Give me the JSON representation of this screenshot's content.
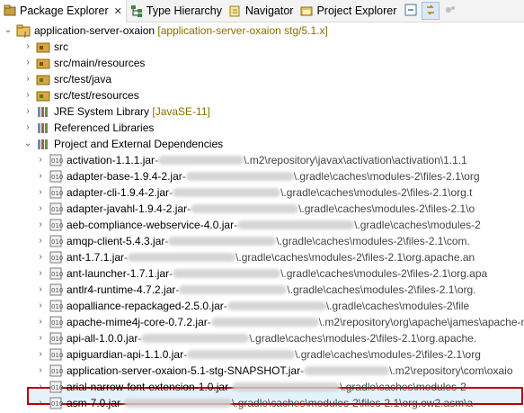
{
  "tabs": [
    {
      "label": "Package Explorer",
      "icon": "package-icon",
      "active": true,
      "close": "✕"
    },
    {
      "label": "Type Hierarchy",
      "icon": "hierarchy-icon"
    },
    {
      "label": "Navigator",
      "icon": "navigator-icon"
    },
    {
      "label": "Project Explorer",
      "icon": "project-explorer-icon"
    }
  ],
  "project": {
    "name": "application-server-oxaion",
    "decoration": "[application-server-oxaion stg/5.1.x]"
  },
  "folders": [
    {
      "label": "src"
    },
    {
      "label": "src/main/resources"
    },
    {
      "label": "src/test/java"
    },
    {
      "label": "src/test/resources"
    },
    {
      "label": "JRE System Library",
      "decoration": "[JavaSE-11]"
    },
    {
      "label": "Referenced Libraries"
    },
    {
      "label": "Project and External Dependencies"
    }
  ],
  "jars": [
    {
      "label": "activation-1.1.1.jar",
      "path": "\\.m2\\repository\\javax\\activation\\activation\\1.1.1"
    },
    {
      "label": "adapter-base-1.9.4-2.jar",
      "path": "\\.gradle\\caches\\modules-2\\files-2.1\\org"
    },
    {
      "label": "adapter-cli-1.9.4-2.jar",
      "path": "\\.gradle\\caches\\modules-2\\files-2.1\\org.t"
    },
    {
      "label": "adapter-javahl-1.9.4-2.jar",
      "path": "\\.gradle\\caches\\modules-2\\files-2.1\\o"
    },
    {
      "label": "aeb-compliance-webservice-4.0.jar",
      "path": "\\.gradle\\caches\\modules-2"
    },
    {
      "label": "amqp-client-5.4.3.jar",
      "path": "\\.gradle\\caches\\modules-2\\files-2.1\\com."
    },
    {
      "label": "ant-1.7.1.jar",
      "path": "\\.gradle\\caches\\modules-2\\files-2.1\\org.apache.an"
    },
    {
      "label": "ant-launcher-1.7.1.jar",
      "path": "\\.gradle\\caches\\modules-2\\files-2.1\\org.apa"
    },
    {
      "label": "antlr4-runtime-4.7.2.jar",
      "path": "\\.gradle\\caches\\modules-2\\files-2.1\\org."
    },
    {
      "label": "aopalliance-repackaged-2.5.0.jar",
      "path": "\\.gradle\\caches\\modules-2\\file"
    },
    {
      "label": "apache-mime4j-core-0.7.2.jar",
      "path": "\\.m2\\repository\\org\\apache\\james\\apache-m"
    },
    {
      "label": "api-all-1.0.0.jar",
      "path": "\\.gradle\\caches\\modules-2\\files-2.1\\org.apache."
    },
    {
      "label": "apiguardian-api-1.1.0.jar",
      "path": "\\.gradle\\caches\\modules-2\\files-2.1\\org"
    },
    {
      "label": "application-server-oxaion-5.1-stg-SNAPSHOT.jar",
      "path": "\\.m2\\repository\\com\\oxaio"
    },
    {
      "label": "arial-narrow-font-extension-1.0.jar",
      "path": "\\.gradle\\caches\\modules-2"
    },
    {
      "label": "asm-7.0.jar",
      "path": "\\.gradle\\caches\\modules-2\\files-2.1\\org.ow2.asm\\a"
    }
  ],
  "separator": " - ",
  "colors": {
    "highlight_border": "#c00000",
    "selection_bg": "#e5f1fb",
    "decoration": "#8a6d00"
  }
}
